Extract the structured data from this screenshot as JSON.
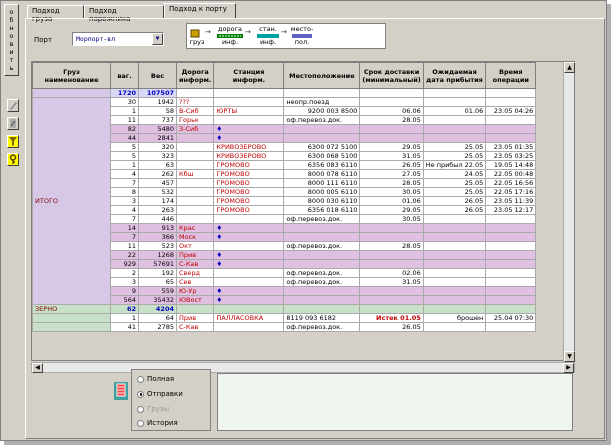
{
  "side_button": {
    "letters": [
      "о",
      "б",
      "н",
      "о",
      "в",
      "и",
      "т",
      "ь"
    ]
  },
  "tabs": [
    {
      "label": "Подход груза"
    },
    {
      "label": "Подход порожника"
    },
    {
      "label": "Подход к порту"
    }
  ],
  "port": {
    "label": "Порт",
    "value": "Морпорт-вл"
  },
  "flow": {
    "step1": "груз",
    "step2_top": "дорога",
    "step2_bottom": "инф.",
    "step3_top": "стан.",
    "step3_bottom": "инф.",
    "step4_top": "место-",
    "step4_bottom": "пол."
  },
  "columns": [
    "Груз наименование",
    "ваг.",
    "Вес",
    "Дорога информ.",
    "Станция информ.",
    "Местоположение",
    "Срок доставки (минимальный)",
    "Ожидаемая дата прибытия",
    "Время операции"
  ],
  "totals": {
    "wagons": "1720",
    "weight": "107507"
  },
  "group_itogo": "ИТОГО",
  "group_zerno": "ЗЕРНО",
  "rows": [
    {
      "vag": "30",
      "ves": "1942",
      "road": "???",
      "station": "",
      "loc": "неопр.поезд",
      "srok": "",
      "expected": "",
      "time": "",
      "hl": false
    },
    {
      "vag": "1",
      "ves": "58",
      "road": "В-Сиб",
      "station": "ЮРТЫ",
      "loc": "9200 003 8500",
      "srok": "06.06",
      "expected": "01.06",
      "time": "23.05 04:26",
      "hl": false
    },
    {
      "vag": "11",
      "ves": "737",
      "road": "Горьк",
      "station": "",
      "loc": "оф.перевоз.док.",
      "srok": "28.05",
      "expected": "",
      "time": "",
      "hl": false
    },
    {
      "vag": "82",
      "ves": "5480",
      "road": "З-Сиб",
      "station": "",
      "loc": "",
      "srok": "",
      "expected": "",
      "time": "",
      "hl": true
    },
    {
      "vag": "44",
      "ves": "2841",
      "road": "",
      "station": "",
      "loc": "",
      "srok": "",
      "expected": "",
      "time": "",
      "hl": true
    },
    {
      "vag": "5",
      "ves": "320",
      "road": "",
      "station": "КРИВОЗЕРОВО",
      "loc": "6300 072 5100",
      "srok": "29.05",
      "expected": "25.05",
      "time": "23.05 01:35",
      "hl": false
    },
    {
      "vag": "5",
      "ves": "323",
      "road": "",
      "station": "КРИВОЗЕРОВО",
      "loc": "6300 068 5100",
      "srok": "31.05",
      "expected": "25.05",
      "time": "23.05 03:25",
      "hl": false
    },
    {
      "vag": "1",
      "ves": "63",
      "road": "",
      "station": "ГРОМОВО",
      "loc": "6356 083 6110",
      "srok": "26.05",
      "expected": "Не прибыл 22.05",
      "time": "19.05 14:48",
      "hl": false
    },
    {
      "vag": "4",
      "ves": "262",
      "road": "Кбш",
      "station": "ГРОМОВО",
      "loc": "8000 078 6110",
      "srok": "27.05",
      "expected": "24.05",
      "time": "22.05 00:48",
      "hl": false
    },
    {
      "vag": "7",
      "ves": "457",
      "road": "",
      "station": "ГРОМОВО",
      "loc": "8000 111 6110",
      "srok": "28.05",
      "expected": "25.05",
      "time": "22.05 16:56",
      "hl": false
    },
    {
      "vag": "8",
      "ves": "532",
      "road": "",
      "station": "ГРОМОВО",
      "loc": "8000 005 6110",
      "srok": "30.05",
      "expected": "25.05",
      "time": "22.05 17:16",
      "hl": false
    },
    {
      "vag": "3",
      "ves": "174",
      "road": "",
      "station": "ГРОМОВО",
      "loc": "8000 030 6110",
      "srok": "01.06",
      "expected": "26.05",
      "time": "23.05 11:39",
      "hl": false
    },
    {
      "vag": "4",
      "ves": "263",
      "road": "",
      "station": "ГРОМОВО",
      "loc": "6356 018 6110",
      "srok": "29.05",
      "expected": "26.05",
      "time": "23.05 12:17",
      "hl": false
    },
    {
      "vag": "7",
      "ves": "446",
      "road": "",
      "station": "",
      "loc": "оф.перевоз.док.",
      "srok": "30.05",
      "expected": "",
      "time": "",
      "hl": false
    },
    {
      "vag": "14",
      "ves": "913",
      "road": "Крас",
      "station": "",
      "loc": "",
      "srok": "",
      "expected": "",
      "time": "",
      "hl": true
    },
    {
      "vag": "7",
      "ves": "366",
      "road": "Моск",
      "station": "",
      "loc": "",
      "srok": "",
      "expected": "",
      "time": "",
      "hl": true
    },
    {
      "vag": "11",
      "ves": "523",
      "road": "Окт",
      "station": "",
      "loc": "оф.перевоз.док.",
      "srok": "28.05",
      "expected": "",
      "time": "",
      "hl": false
    },
    {
      "vag": "22",
      "ves": "1268",
      "road": "Прив",
      "station": "",
      "loc": "",
      "srok": "",
      "expected": "",
      "time": "",
      "hl": true
    },
    {
      "vag": "929",
      "ves": "57691",
      "road": "С-Кав",
      "station": "",
      "loc": "",
      "srok": "",
      "expected": "",
      "time": "",
      "hl": true
    },
    {
      "vag": "2",
      "ves": "192",
      "road": "Сверд",
      "station": "",
      "loc": "оф.перевоз.док.",
      "srok": "02.06",
      "expected": "",
      "time": "",
      "hl": false
    },
    {
      "vag": "3",
      "ves": "65",
      "road": "Сев",
      "station": "",
      "loc": "оф.перевоз.док.",
      "srok": "31.05",
      "expected": "",
      "time": "",
      "hl": false
    },
    {
      "vag": "9",
      "ves": "559",
      "road": "Ю-Ур",
      "station": "",
      "loc": "",
      "srok": "",
      "expected": "",
      "time": "",
      "hl": true
    },
    {
      "vag": "564",
      "ves": "35432",
      "road": "ЮВост",
      "station": "",
      "loc": "",
      "srok": "",
      "expected": "",
      "time": "",
      "hl": true
    }
  ],
  "zerno_total": {
    "vag": "62",
    "ves": "4204"
  },
  "zerno_rows": [
    {
      "vag": "1",
      "ves": "64",
      "road": "Прив",
      "station": "ПАЛЛАСОВКА",
      "loc": "8119 093 6182",
      "srok": "Истек 01.05",
      "expected": "брошен",
      "time": "25.04 07:30"
    },
    {
      "vag": "41",
      "ves": "2785",
      "road": "С-Кав",
      "station": "",
      "loc": "оф.перевоз.док.",
      "srok": "26.05",
      "expected": "",
      "time": ""
    }
  ],
  "radio": {
    "full": "Полная",
    "sends": "Отправки",
    "cargo": "Грузы",
    "history": "История"
  },
  "colors": {
    "highlight": "#e0c0e0",
    "total": "#0000c0",
    "road": "#c00000",
    "station": "#c00000"
  }
}
